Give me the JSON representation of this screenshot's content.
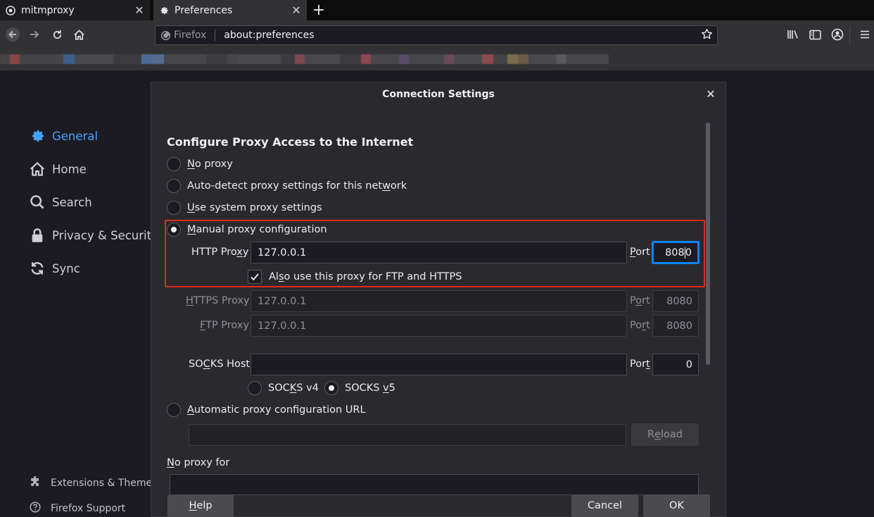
{
  "tabs": [
    {
      "label": "mitmproxy",
      "icon": "mitmproxy-icon"
    },
    {
      "label": "Preferences",
      "icon": "gear-icon"
    }
  ],
  "urlbar": {
    "identity": "Firefox",
    "url": "about:preferences"
  },
  "sidebar": {
    "items": [
      {
        "label": "General",
        "icon": "gear-icon",
        "selected": true
      },
      {
        "label": "Home",
        "icon": "home-icon"
      },
      {
        "label": "Search",
        "icon": "search-icon"
      },
      {
        "label": "Privacy & Security",
        "icon": "lock-icon"
      },
      {
        "label": "Sync",
        "icon": "sync-icon"
      }
    ],
    "footer": [
      {
        "label": "Extensions & Themes",
        "icon": "puzzle-icon"
      },
      {
        "label": "Firefox Support",
        "icon": "help-icon"
      }
    ]
  },
  "dialog": {
    "title": "Connection Settings",
    "section_title": "Configure Proxy Access to the Internet",
    "proxy_options": {
      "no_proxy": "No proxy",
      "auto_detect": "Auto-detect proxy settings for this network",
      "system": "Use system proxy settings",
      "manual": "Manual proxy configuration",
      "auto_url": "Automatic proxy configuration URL"
    },
    "selected_option": "manual",
    "http_proxy": {
      "label": "HTTP Proxy",
      "value": "127.0.0.1",
      "port_label": "Port",
      "port": "8080"
    },
    "also_use_for_ftp_https": {
      "label": "Also use this proxy for FTP and HTTPS",
      "checked": true
    },
    "https_proxy": {
      "label": "HTTPS Proxy",
      "value": "127.0.0.1",
      "port_label": "Port",
      "port": "8080"
    },
    "ftp_proxy": {
      "label": "FTP Proxy",
      "value": "127.0.0.1",
      "port_label": "Port",
      "port": "8080"
    },
    "socks_host": {
      "label": "SOCKS Host",
      "value": "",
      "port_label": "Port",
      "port": "0"
    },
    "socks_version": {
      "v4": "SOCKS v4",
      "v5": "SOCKS v5",
      "selected": "v5"
    },
    "auto_url_value": "",
    "reload_label": "Reload",
    "no_proxy_for_label": "No proxy for",
    "buttons": {
      "help": "Help",
      "cancel": "Cancel",
      "ok": "OK"
    }
  },
  "colors": {
    "accent": "#0a84ff",
    "selected_sidebar": "#45a1ff",
    "highlight_box": "#e0281e"
  }
}
